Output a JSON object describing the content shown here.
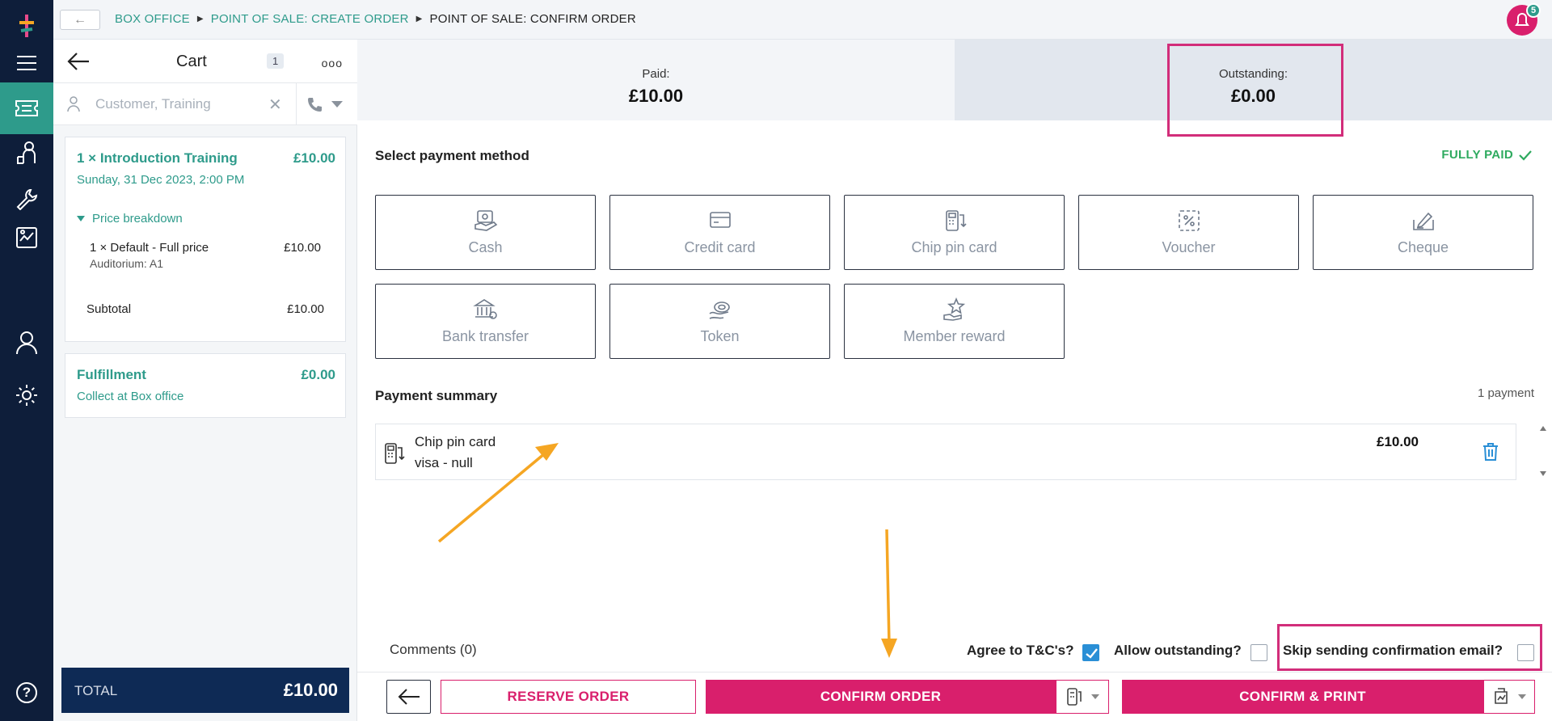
{
  "nav": {
    "items": [
      {
        "name": "menu",
        "active": false
      },
      {
        "name": "tickets",
        "active": true
      },
      {
        "name": "customer-service",
        "active": false
      },
      {
        "name": "tools",
        "active": false
      },
      {
        "name": "reports",
        "active": false
      },
      {
        "name": "user",
        "active": false
      },
      {
        "name": "settings",
        "active": false
      }
    ],
    "help": "?"
  },
  "breadcrumb": {
    "back": "←",
    "items": [
      "BOX OFFICE",
      "POINT OF SALE: CREATE ORDER",
      "POINT OF SALE: CONFIRM ORDER"
    ]
  },
  "notifications": {
    "count": "5"
  },
  "cart": {
    "title": "Cart",
    "count": "1",
    "more": "ooo",
    "customer_placeholder": "Customer, Training",
    "clear": "✕",
    "item": {
      "title": "1 × Introduction Training",
      "price": "£10.00",
      "date": "Sunday, 31 Dec 2023, 2:00 PM",
      "breakdown_label": "Price breakdown",
      "line_label": "1 × Default - Full price",
      "line_sub": "Auditorium: A1",
      "line_price": "£10.00",
      "subtotal_label": "Subtotal",
      "subtotal_value": "£10.00"
    },
    "fulfillment": {
      "title": "Fulfillment",
      "price": "£0.00",
      "method": "Collect at Box office"
    },
    "total_label": "TOTAL",
    "total_value": "£10.00"
  },
  "summary": {
    "paid_label": "Paid:",
    "paid_value": "£10.00",
    "outstanding_label": "Outstanding:",
    "outstanding_value": "£0.00"
  },
  "payment_methods": {
    "title": "Select payment method",
    "status": "FULLY PAID",
    "items": [
      "Cash",
      "Credit card",
      "Chip pin card",
      "Voucher",
      "Cheque",
      "Bank transfer",
      "Token",
      "Member reward"
    ]
  },
  "payment_summary": {
    "title": "Payment summary",
    "count": "1 payment",
    "payment": {
      "method": "Chip pin card",
      "detail": "visa - null",
      "amount": "£10.00"
    }
  },
  "footer": {
    "comments": "Comments (0)",
    "agree_label": "Agree to T&C's?",
    "agree_checked": true,
    "allow_label": "Allow outstanding?",
    "allow_checked": false,
    "skip_label": "Skip sending confirmation email?",
    "skip_checked": false,
    "reserve": "RESERVE ORDER",
    "confirm": "CONFIRM ORDER",
    "confirm_print": "CONFIRM & PRINT"
  },
  "colors": {
    "nav_bg": "#0e1e3a",
    "accent_teal": "#2e9b8b",
    "brand_pink": "#d91f6c",
    "annotation_orange": "#f5a623",
    "success_green": "#2eaa5f"
  }
}
